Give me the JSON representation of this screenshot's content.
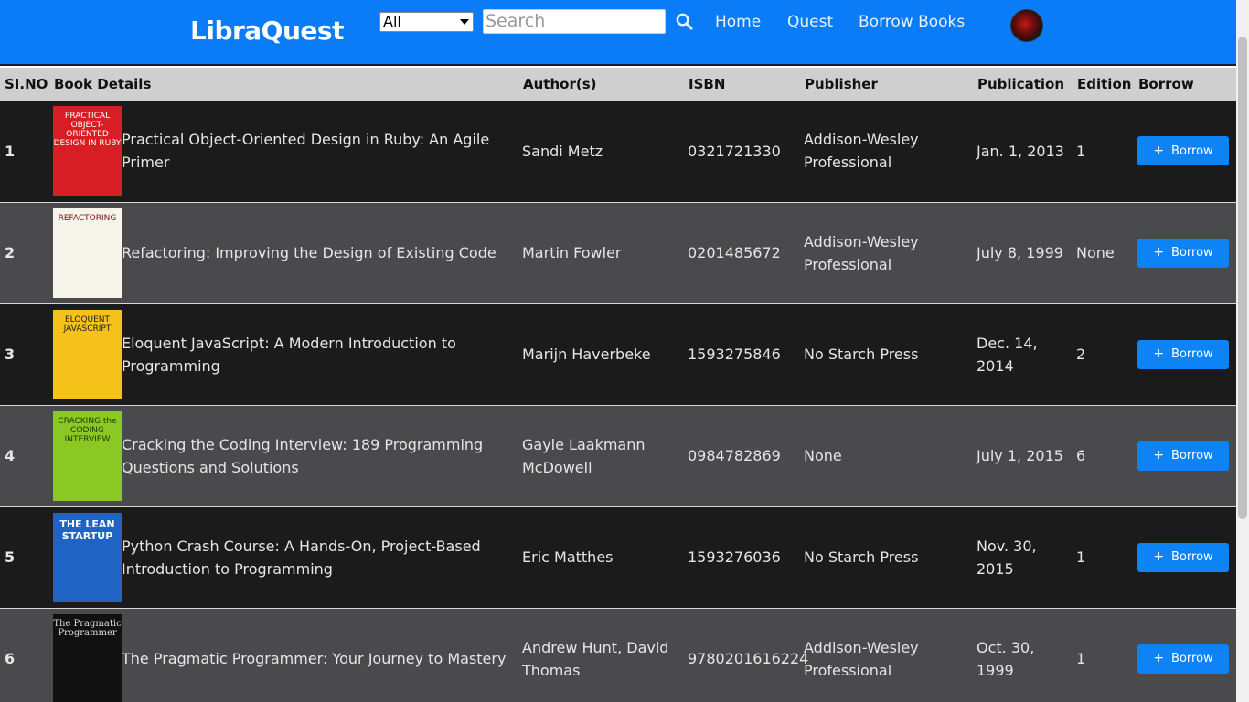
{
  "brand": "LibraQuest",
  "filter": {
    "selected": "All"
  },
  "search": {
    "placeholder": "Search"
  },
  "nav": [
    "Home",
    "Quest",
    "Borrow Books"
  ],
  "table": {
    "headers": [
      "SI.NO",
      "Book Details",
      "Author(s)",
      "ISBN",
      "Publisher",
      "Publication",
      "Edition",
      "Borrow"
    ],
    "rows": [
      {
        "sno": "1",
        "title": "Practical Object-Oriented Design in Ruby: An Agile Primer",
        "author": "Sandi Metz",
        "isbn": "0321721330",
        "publisher": "Addison-Wesley Professional",
        "publication": "Jan. 1, 2013",
        "edition": "1",
        "borrow": "Borrow",
        "cover_text": "PRACTICAL OBJECT-ORIENTED DESIGN IN RUBY"
      },
      {
        "sno": "2",
        "title": "Refactoring: Improving the Design of Existing Code",
        "author": "Martin Fowler",
        "isbn": "0201485672",
        "publisher": "Addison-Wesley Professional",
        "publication": "July 8, 1999",
        "edition": "None",
        "borrow": "Borrow",
        "cover_text": "REFACTORING"
      },
      {
        "sno": "3",
        "title": "Eloquent JavaScript: A Modern Introduction to Programming",
        "author": "Marijn Haverbeke",
        "isbn": "1593275846",
        "publisher": "No Starch Press",
        "publication": "Dec. 14, 2014",
        "edition": "2",
        "borrow": "Borrow",
        "cover_text": "ELOQUENT JAVASCRIPT"
      },
      {
        "sno": "4",
        "title": "Cracking the Coding Interview: 189 Programming Questions and Solutions",
        "author": "Gayle Laakmann McDowell",
        "isbn": "0984782869",
        "publisher": "None",
        "publication": "July 1, 2015",
        "edition": "6",
        "borrow": "Borrow",
        "cover_text": "CRACKING the CODING INTERVIEW"
      },
      {
        "sno": "5",
        "title": "Python Crash Course: A Hands-On, Project-Based Introduction to Programming",
        "author": "Eric Matthes",
        "isbn": "1593276036",
        "publisher": "No Starch Press",
        "publication": "Nov. 30, 2015",
        "edition": "1",
        "borrow": "Borrow",
        "cover_text": "THE LEAN STARTUP"
      },
      {
        "sno": "6",
        "title": "The Pragmatic Programmer: Your Journey to Mastery",
        "author": "Andrew Hunt, David Thomas",
        "isbn": "9780201616224",
        "publisher": "Addison-Wesley Professional",
        "publication": "Oct. 30, 1999",
        "edition": "1",
        "borrow": "Borrow",
        "cover_text": "The Pragmatic Programmer"
      }
    ]
  },
  "colors": {
    "navbar": "#0a7cf7",
    "accent_button": "#0d83f5",
    "row_dark": "#1b1b1c",
    "row_light": "#4a494b",
    "header_bg": "#cfcfcf"
  },
  "icons": {
    "search": "search-icon",
    "borrow": "plus-icon",
    "avatar": "user-avatar"
  }
}
